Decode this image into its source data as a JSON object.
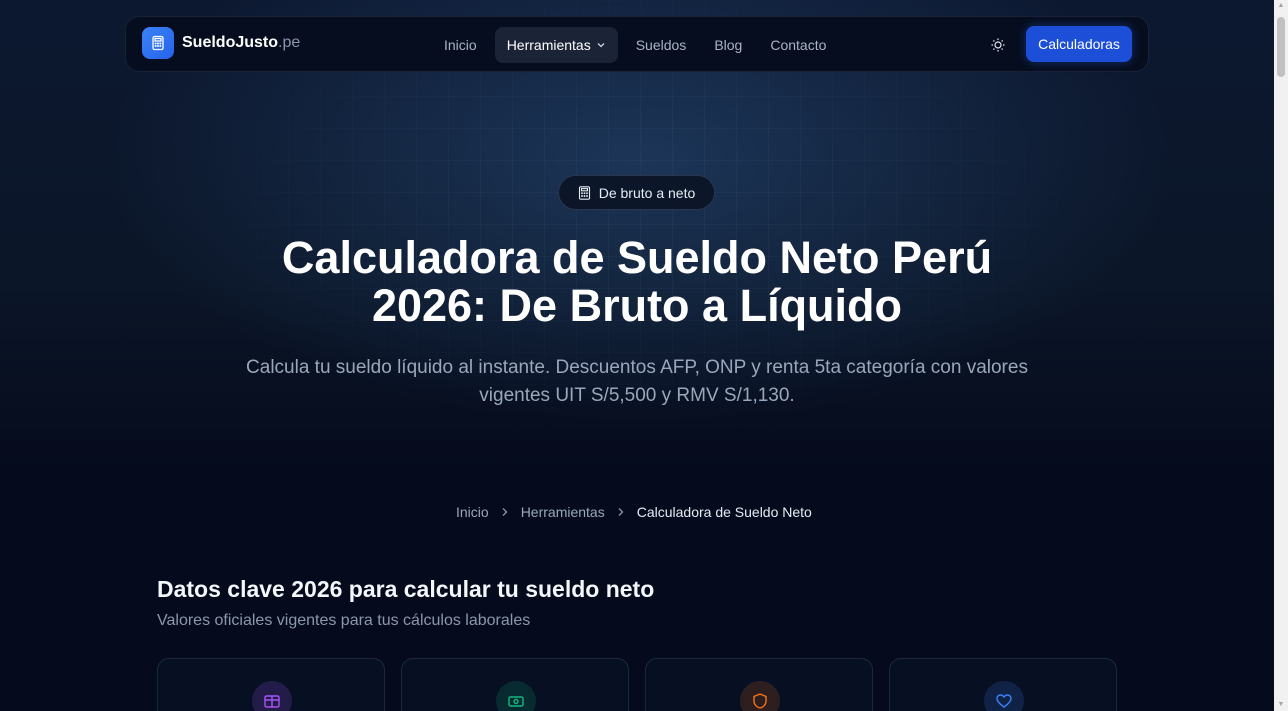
{
  "nav": {
    "logo_name": "SueldoJusto",
    "logo_tld": ".pe",
    "links": [
      {
        "label": "Inicio"
      },
      {
        "label": "Herramientas"
      },
      {
        "label": "Sueldos"
      },
      {
        "label": "Blog"
      },
      {
        "label": "Contacto"
      }
    ],
    "cta_label": "Calculadoras"
  },
  "hero": {
    "badge": "De bruto a neto",
    "title": "Calculadora de Sueldo Neto Perú 2026: De Bruto a Líquido",
    "subtitle": "Calcula tu sueldo líquido al instante. Descuentos AFP, ONP y renta 5ta categoría con valores vigentes UIT S/5,500 y RMV S/1,130."
  },
  "breadcrumb": {
    "items": [
      {
        "label": "Inicio"
      },
      {
        "label": "Herramientas"
      },
      {
        "label": "Calculadora de Sueldo Neto"
      }
    ]
  },
  "section": {
    "title": "Datos clave 2026 para calcular tu sueldo neto",
    "subtitle": "Valores oficiales vigentes para tus cálculos laborales"
  },
  "cards": [
    {
      "icon": "briefcase-icon",
      "color": "#a855f7"
    },
    {
      "icon": "banknote-icon",
      "color": "#10b981"
    },
    {
      "icon": "shield-icon",
      "color": "#f97316"
    },
    {
      "icon": "heart-icon",
      "color": "#3b82f6"
    }
  ]
}
